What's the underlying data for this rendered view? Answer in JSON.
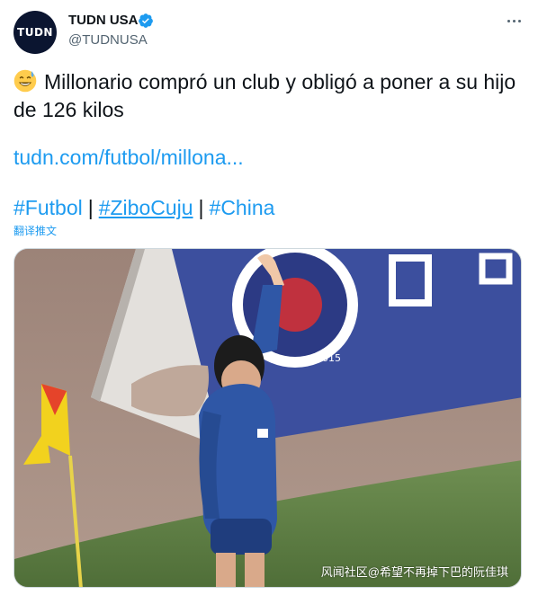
{
  "author": {
    "avatar_text": "TUDN",
    "name": "TUDN USA",
    "handle": "@TUDNUSA",
    "verified": true
  },
  "tweet": {
    "emoji": "grinning-sweat-emoji",
    "text": "Millonario compró un club y obligó a poner a su hijo de 126 kilos",
    "link": "tudn.com/futbol/millona...",
    "hashtags": [
      "#Futbol",
      "#ZiboCuju",
      "#China"
    ],
    "separator": "|",
    "translate_label": "翻译推文"
  },
  "media": {
    "banner_year": "2015",
    "watermark": "风闻社区@希望不再掉下巴的阮佳琪"
  },
  "colors": {
    "link": "#1d9bf0",
    "text": "#0f1419",
    "muted": "#536471",
    "banner": "#3c4f9e"
  }
}
